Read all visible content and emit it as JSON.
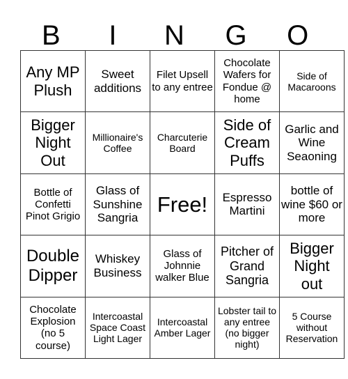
{
  "header": [
    "B",
    "I",
    "N",
    "G",
    "O"
  ],
  "cells": [
    [
      "Any MP Plush",
      "Sweet additions",
      "Filet Upsell to any entree",
      "Chocolate Wafers for Fondue @ home",
      "Side of Macaroons"
    ],
    [
      "Bigger Night Out",
      "Millionaire's Coffee",
      "Charcuterie Board",
      "Side of Cream Puffs",
      "Garlic and Wine Seaoning"
    ],
    [
      "Bottle of Confetti Pinot Grigio",
      "Glass of Sunshine Sangria",
      "Free!",
      "Espresso Martini",
      "bottle of wine $60 or more"
    ],
    [
      "Double Dipper",
      "Whiskey Business",
      "Glass of Johnnie walker Blue",
      "Pitcher of Grand Sangria",
      "Bigger Night out"
    ],
    [
      "Chocolate Explosion (no 5 course)",
      "Intercoastal Space Coast Light Lager",
      "Intercoastal Amber Lager",
      "Lobster tail to any entree (no bigger night)",
      "5 Course without Reservation"
    ]
  ],
  "free_space": {
    "row": 2,
    "col": 2
  }
}
